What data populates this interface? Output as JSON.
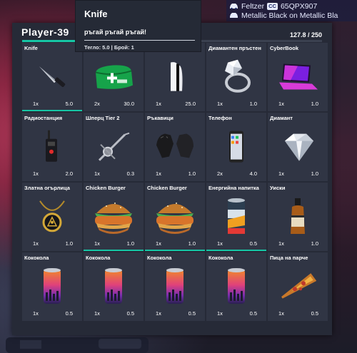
{
  "hud": {
    "player_label": "Feltzer",
    "plate_badge": "CC",
    "plate": "65QPX907",
    "color_label": "Metallic Black on Metallic Bla"
  },
  "inventory": {
    "title": "Player-39",
    "weight_text": "127.8 / 250",
    "weight_fraction": 0.51,
    "accent_color": "#16c6a5",
    "slots": [
      {
        "label": "Knife",
        "count": "1x",
        "weight": "5.0",
        "icon": "knife-icon",
        "durability": 1
      },
      {
        "label": "",
        "count": "2x",
        "weight": "30.0",
        "icon": "medkit-icon",
        "durability": 0
      },
      {
        "label": "PS5",
        "count": "1x",
        "weight": "25.0",
        "icon": "console-icon",
        "durability": 0
      },
      {
        "label": "Диамантен пръстен",
        "count": "1x",
        "weight": "1.0",
        "icon": "ring-icon",
        "durability": 0
      },
      {
        "label": "CyberBook",
        "count": "1x",
        "weight": "1.0",
        "icon": "laptop-icon",
        "durability": 0
      },
      {
        "label": "Радиостанция",
        "count": "1x",
        "weight": "2.0",
        "icon": "radio-icon",
        "durability": 0
      },
      {
        "label": "Шперц Tier 2",
        "count": "1x",
        "weight": "0.3",
        "icon": "lockpick-icon",
        "durability": 0
      },
      {
        "label": "Ръкавици",
        "count": "1x",
        "weight": "1.0",
        "icon": "gloves-icon",
        "durability": 0
      },
      {
        "label": "Телефон",
        "count": "2x",
        "weight": "4.0",
        "icon": "phone-icon",
        "durability": 0
      },
      {
        "label": "Диамант",
        "count": "1x",
        "weight": "1.0",
        "icon": "diamond-icon",
        "durability": 0
      },
      {
        "label": "Златна огърлица",
        "count": "1x",
        "weight": "1.0",
        "icon": "necklace-icon",
        "durability": 0
      },
      {
        "label": "Chicken Burger",
        "count": "1x",
        "weight": "1.0",
        "icon": "burger-icon",
        "durability": 1
      },
      {
        "label": "Chicken Burger",
        "count": "1x",
        "weight": "1.0",
        "icon": "burger-icon",
        "durability": 1
      },
      {
        "label": "Енергийна напитка",
        "count": "1x",
        "weight": "0.5",
        "icon": "energy-can-icon",
        "durability": 1
      },
      {
        "label": "Уиски",
        "count": "1x",
        "weight": "1.0",
        "icon": "whiskey-icon",
        "durability": 0
      },
      {
        "label": "Кококола",
        "count": "1x",
        "weight": "0.5",
        "icon": "soda-can-icon",
        "durability": 0
      },
      {
        "label": "Кококола",
        "count": "1x",
        "weight": "0.5",
        "icon": "soda-can-icon",
        "durability": 0
      },
      {
        "label": "Кококола",
        "count": "1x",
        "weight": "0.5",
        "icon": "soda-can-icon",
        "durability": 0
      },
      {
        "label": "Кококола",
        "count": "1x",
        "weight": "0.5",
        "icon": "soda-can-icon",
        "durability": 0
      },
      {
        "label": "Пица на парче",
        "count": "1x",
        "weight": "0.5",
        "icon": "pizza-icon",
        "durability": 0
      }
    ]
  },
  "tooltip": {
    "title": "Knife",
    "description": "ръгай ръгай ръгай!",
    "info": "Тегло: 5.0 | Брой: 1"
  }
}
